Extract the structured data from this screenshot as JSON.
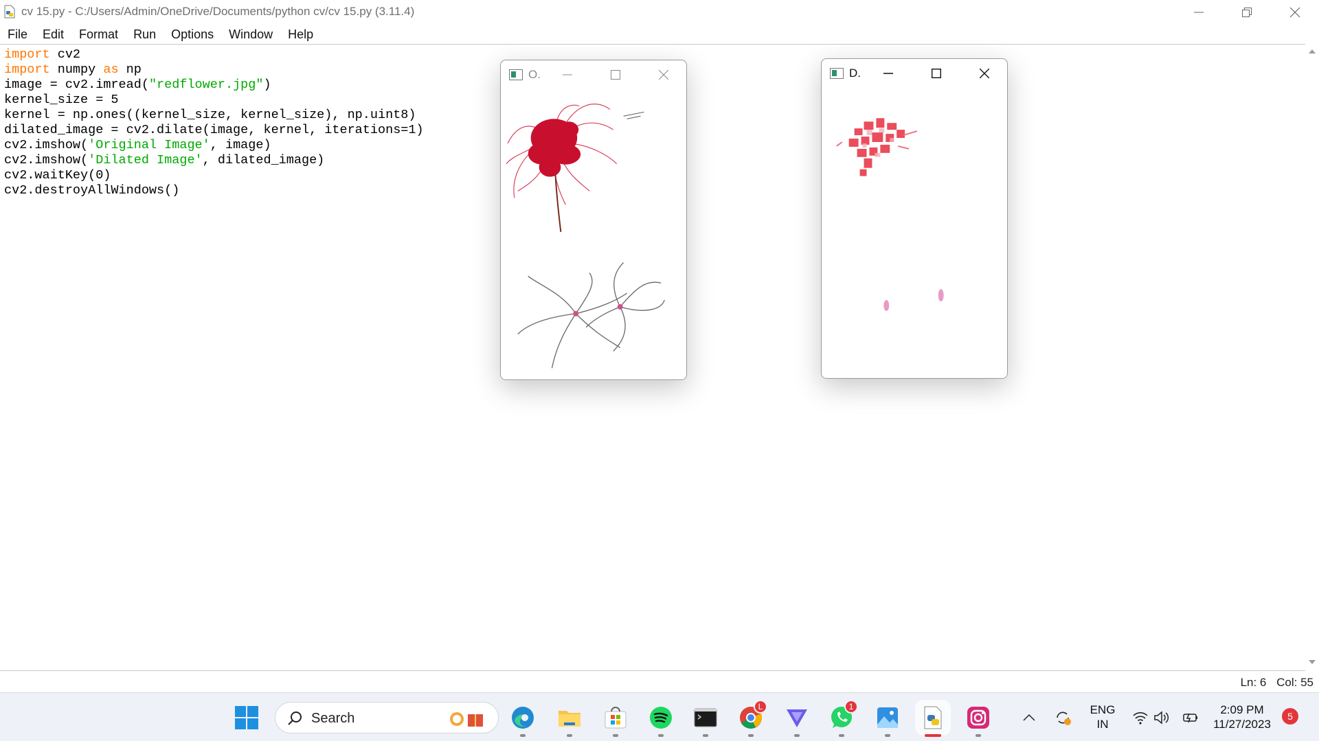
{
  "window": {
    "title": "cv 15.py - C:/Users/Admin/OneDrive/Documents/python cv/cv 15.py (3.11.4)"
  },
  "menu": [
    "File",
    "Edit",
    "Format",
    "Run",
    "Options",
    "Window",
    "Help"
  ],
  "code_lines": [
    [
      {
        "t": "import",
        "c": "kw"
      },
      {
        "t": " cv2"
      }
    ],
    [
      {
        "t": "import",
        "c": "kw"
      },
      {
        "t": " numpy "
      },
      {
        "t": "as",
        "c": "kw"
      },
      {
        "t": " np"
      }
    ],
    [
      {
        "t": "image = cv2.imread("
      },
      {
        "t": "\"redflower.jpg\"",
        "c": "str"
      },
      {
        "t": ")"
      }
    ],
    [
      {
        "t": "kernel_size = 5"
      }
    ],
    [
      {
        "t": "kernel = np.ones((kernel_size, kernel_size), np.uint8)"
      }
    ],
    [
      {
        "t": "dilated_image = cv2.dilate(image, kernel, iterations=1)"
      }
    ],
    [
      {
        "t": "cv2.imshow("
      },
      {
        "t": "'Original Image'",
        "c": "str"
      },
      {
        "t": ", image)"
      }
    ],
    [
      {
        "t": "cv2.imshow("
      },
      {
        "t": "'Dilated Image'",
        "c": "str"
      },
      {
        "t": ", dilated_image)"
      }
    ],
    [
      {
        "t": "cv2.waitKey(0)"
      }
    ],
    [
      {
        "t": "cv2.destroyAllWindows()"
      }
    ]
  ],
  "status": {
    "line": "Ln: 6",
    "col": "Col: 55"
  },
  "cv_windows": {
    "original": {
      "label": "O."
    },
    "dilated": {
      "label": "D."
    }
  },
  "taskbar": {
    "search_label": "Search",
    "apps": [
      {
        "name": "edge-icon"
      },
      {
        "name": "file-explorer-icon"
      },
      {
        "name": "microsoft-store-icon"
      },
      {
        "name": "spotify-icon"
      },
      {
        "name": "terminal-icon"
      },
      {
        "name": "chrome-icon",
        "badge": "L"
      },
      {
        "name": "vpn-icon"
      },
      {
        "name": "whatsapp-icon",
        "badge": "1"
      },
      {
        "name": "photos-icon"
      },
      {
        "name": "python-idle-icon"
      },
      {
        "name": "instagram-icon"
      }
    ],
    "tray": {
      "lang_top": "ENG",
      "lang_bottom": "IN",
      "time": "2:09 PM",
      "date": "11/27/2023",
      "notifications": "5"
    }
  },
  "colors": {
    "keyword": "#ff7700",
    "string": "#00aa00",
    "taskbar_bg": "#eef1f7"
  }
}
